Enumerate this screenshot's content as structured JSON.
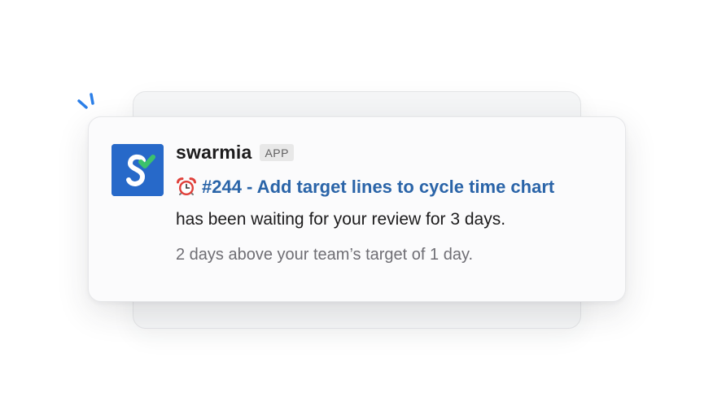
{
  "notification": {
    "app_name": "swarmia",
    "app_badge": "APP",
    "pr_title": "#244 - Add target lines to cycle time chart",
    "message": "has been waiting for your review for 3 days.",
    "subtext": "2 days above your team’s target of 1 day."
  },
  "icons": {
    "avatar": "swarmia-logo-icon",
    "alarm": "alarm-clock-icon",
    "sparkle": "sparkle-icon"
  },
  "colors": {
    "avatar_bg": "#2769c9",
    "avatar_check": "#3cc26b",
    "link": "#2a64a8",
    "sparkle": "#2b7fe8"
  }
}
